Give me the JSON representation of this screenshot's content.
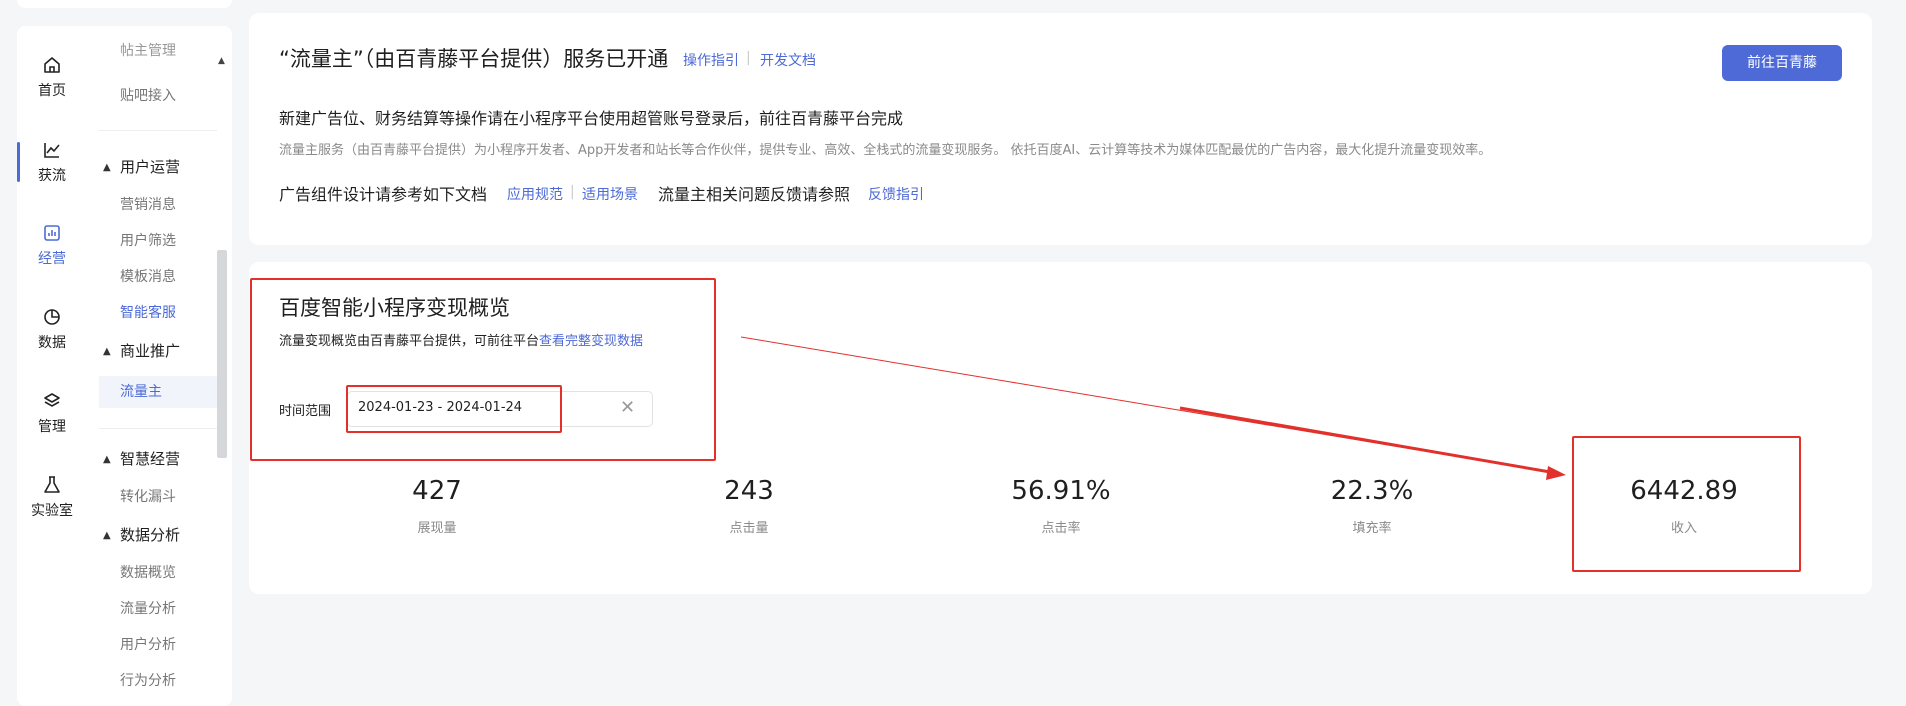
{
  "sidebar": {
    "rail": [
      {
        "label": "首页",
        "icon": "home-icon"
      },
      {
        "label": "获流",
        "icon": "line-chart-icon"
      },
      {
        "label": "经营",
        "icon": "bar-chart-icon"
      },
      {
        "label": "数据",
        "icon": "pie-chart-icon"
      },
      {
        "label": "管理",
        "icon": "layers-icon"
      },
      {
        "label": "实验室",
        "icon": "flask-icon"
      }
    ],
    "submenu": {
      "item_cut": "帖主管理",
      "item_tieba": "贴吧接入",
      "group_user_ops": "用户运营",
      "item_marketing": "营销消息",
      "item_user_filter": "用户筛选",
      "item_template": "模板消息",
      "item_smart_cs": "智能客服",
      "group_biz": "商业推广",
      "item_traffic": "流量主",
      "group_smart_ops": "智慧经营",
      "item_funnel": "转化漏斗",
      "group_data": "数据分析",
      "item_overview": "数据概览",
      "item_traffic_analysis": "流量分析",
      "item_user_analysis": "用户分析",
      "item_behavior": "行为分析"
    }
  },
  "service_card": {
    "title": "“流量主”（由百青藤平台提供）服务已开通",
    "link_guide": "操作指引",
    "link_dev_docs": "开发文档",
    "button_label": "前往百青藤",
    "notice": "新建广告位、财务结算等操作请在小程序平台使用超管账号登录后，前往百青藤平台完成",
    "description": "流量主服务（由百青藤平台提供）为小程序开发者、App开发者和站长等合作伙伴，提供专业、高效、全栈式的流量变现服务。 依托百度AI、云计算等技术为媒体匹配最优的广告内容，最大化提升流量变现效率。",
    "ref_text": "广告组件设计请参考如下文档",
    "link_spec": "应用规范",
    "link_scene": "适用场景",
    "feedback_text": "流量主相关问题反馈请参照",
    "link_feedback": "反馈指引"
  },
  "overview_card": {
    "title": "百度智能小程序变现概览",
    "subtitle_prefix": "流量变现概览由百青藤平台提供，可前往平台",
    "subtitle_link": "查看完整变现数据",
    "time_range_label": "时间范围",
    "date_range_value": "2024-01-23 - 2024-01-24",
    "metrics": [
      {
        "value": "427",
        "label": "展现量"
      },
      {
        "value": "243",
        "label": "点击量"
      },
      {
        "value": "56.91%",
        "label": "点击率"
      },
      {
        "value": "22.3%",
        "label": "填充率"
      },
      {
        "value": "6442.89",
        "label": "收入"
      }
    ]
  },
  "colors": {
    "accent": "#4d6ad6",
    "annotation_red": "#e2302b"
  }
}
